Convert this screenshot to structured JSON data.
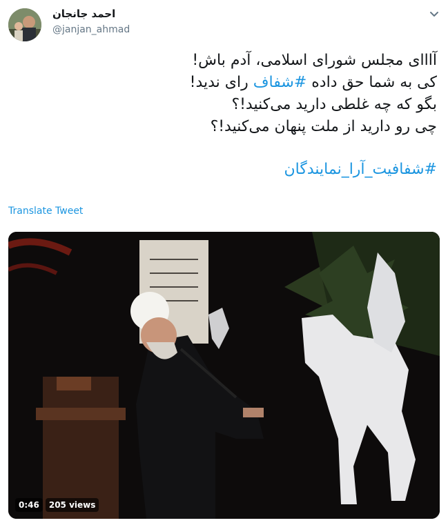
{
  "author": {
    "name": "احمد جانجان",
    "handle": "@janjan_ahmad"
  },
  "tweet": {
    "line1": "آااای مجلس شورای اسلامی، آدم باش!",
    "line2_before": "کی به شما حق داده ",
    "line2_hashtag": "#شفاف",
    "line2_after": " رای ندید!",
    "line3": "بگو که چه غلطی دارید می‌کنید!؟",
    "line4": "چی رو دارید از ملت پنهان می‌کنید!؟",
    "hashtag_line": "#شفافیت_آرا_نمایندگان"
  },
  "translate_label": "Translate Tweet",
  "video": {
    "duration": "0:46",
    "views": "205 views"
  },
  "colors": {
    "link": "#1b95e0",
    "secondary_text": "#657786"
  },
  "icons": {
    "menu": "chevron-down-icon"
  }
}
